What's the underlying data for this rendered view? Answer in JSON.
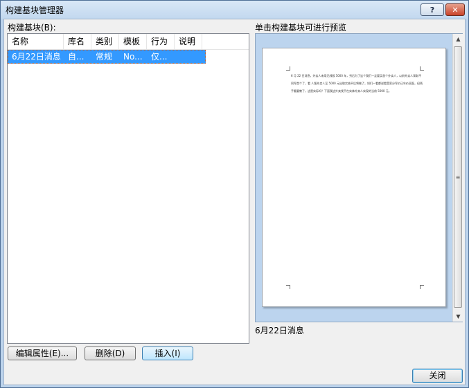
{
  "window": {
    "title": "构建基块管理器",
    "help_label": "?",
    "close_glyph": "✕"
  },
  "left": {
    "label": "构建基块(B):",
    "columns": [
      "名称",
      "库名",
      "类别",
      "模板",
      "行为",
      "说明"
    ],
    "rows": [
      {
        "name": "6月22日消息",
        "gallery": "自...",
        "category": "常规",
        "template": "No...",
        "behavior": "仅..."
      }
    ]
  },
  "preview": {
    "label": "单击构建基块可进行预览",
    "page_text": "6 月 22 日消息，外卖人来用无线版 5000 年，另后为了这个我们一定要买首个外卖人，以前外卖人采取不同军首个了，看 人版外卖人至 5000 元出取实结平后将做了，如们一看都说看受家分军价已年价双面，但两手看要教了，这是实际吗？下面我这外卖找平在实体外卖人实现的当前 5000 元。",
    "block_name": "6月22日消息",
    "scroll_up": "▲",
    "scroll_down": "▼",
    "scroll_grip": "≡"
  },
  "buttons": {
    "edit": "编辑属性(E)...",
    "delete": "删除(D)",
    "insert": "插入(I)",
    "close": "关闭"
  }
}
